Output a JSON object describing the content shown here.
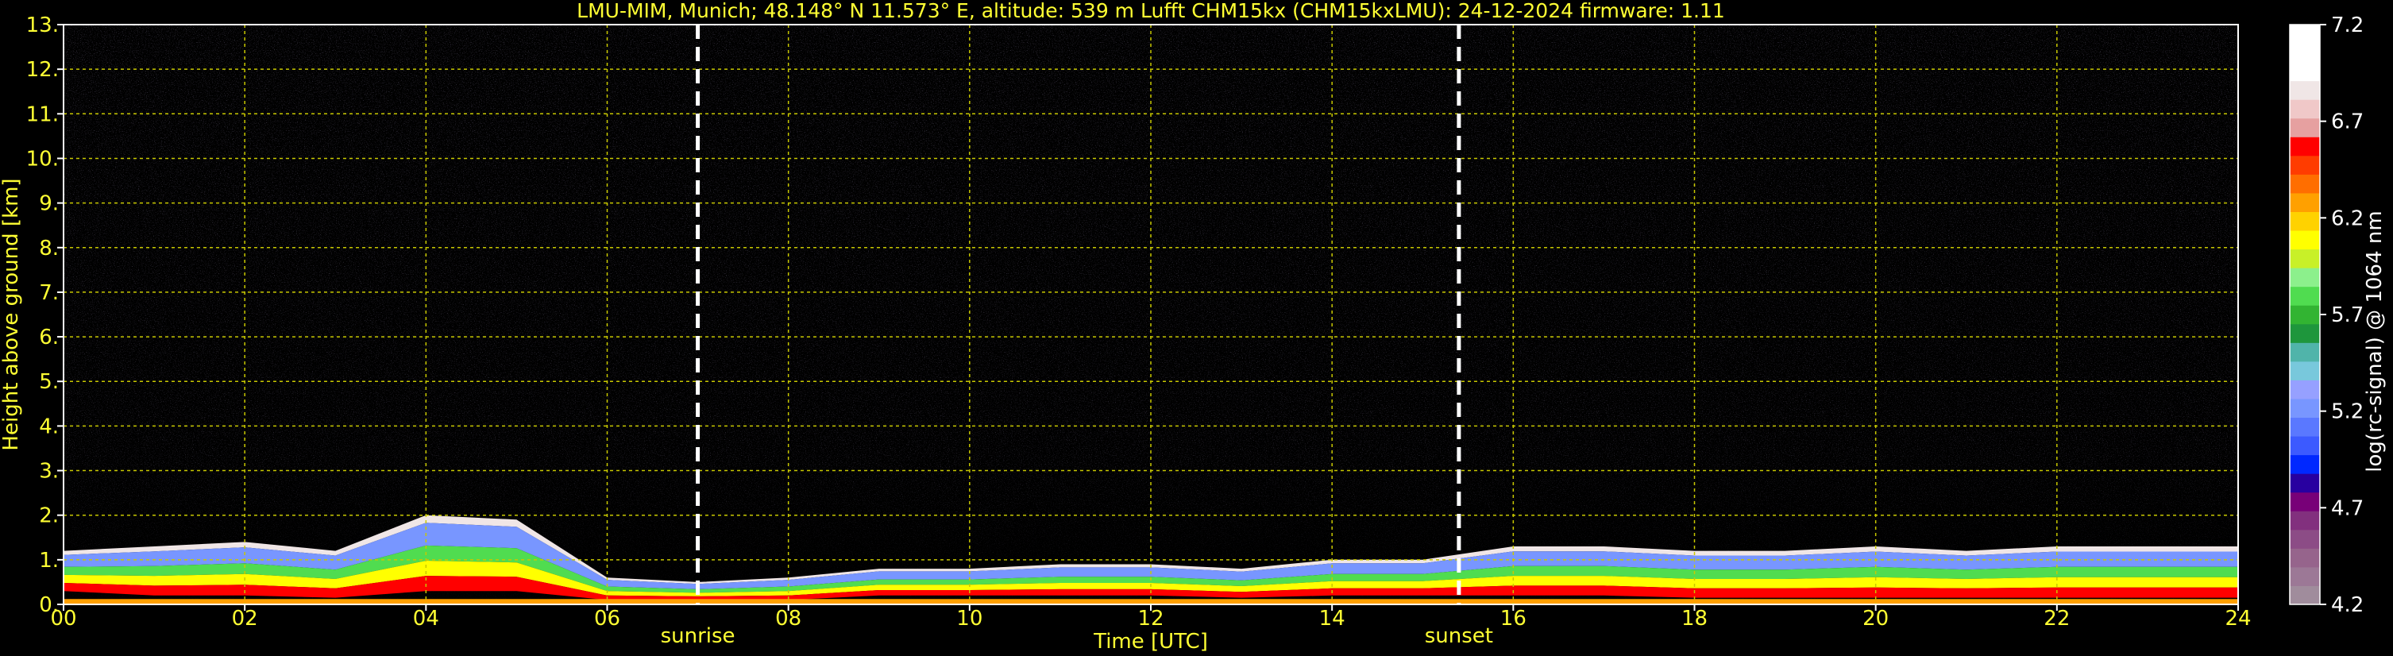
{
  "chart_data": {
    "type": "heatmap",
    "title": "LMU-MIM, Munich; 48.148° N 11.573° E, altitude: 539 m    Lufft CHM15kx (CHM15kxLMU): 24-12-2024    firmware: 1.11",
    "xlabel": "Time [UTC]",
    "ylabel": "Height above ground [km]",
    "xlim": [
      0,
      24
    ],
    "ylim": [
      0,
      13
    ],
    "x_ticks": [
      "00",
      "02",
      "04",
      "06",
      "08",
      "10",
      "12",
      "14",
      "16",
      "18",
      "20",
      "22",
      "24"
    ],
    "y_ticks": [
      "0.",
      "1.",
      "2.",
      "3.",
      "4.",
      "5.",
      "6.",
      "7.",
      "8.",
      "9.",
      "10.",
      "11.",
      "12.",
      "13."
    ],
    "grid": true,
    "colorbar": {
      "label": "log(rc-signal) @ 1064 nm",
      "range": [
        4.2,
        7.2
      ],
      "ticks": [
        "4.2",
        "4.7",
        "5.2",
        "5.7",
        "6.2",
        "6.7",
        "7.2"
      ],
      "colors": [
        "#a08c9c",
        "#9c7896",
        "#96648c",
        "#8c4c86",
        "#82307e",
        "#780078",
        "#2800a0",
        "#0028ff",
        "#3c5aff",
        "#5a78ff",
        "#7896ff",
        "#96a0ff",
        "#78c8dc",
        "#50b4aa",
        "#1e963c",
        "#32b432",
        "#50dc50",
        "#8cf08c",
        "#c8f028",
        "#ffff00",
        "#ffd200",
        "#ffa000",
        "#ff6e00",
        "#ff3c00",
        "#ff0000",
        "#e6a0a0",
        "#f0c8c8",
        "#f0e6e6",
        "#ffffff",
        "#ffffff",
        "#ffffff"
      ]
    },
    "annotations": [
      {
        "text": "sunrise",
        "x": 7.0
      },
      {
        "text": "sunset",
        "x": 15.4
      }
    ],
    "boundary_layer": [
      {
        "x": 0.0,
        "top": 1.2,
        "base": 0.3
      },
      {
        "x": 1.0,
        "top": 1.3,
        "base": 0.2
      },
      {
        "x": 2.0,
        "top": 1.4,
        "base": 0.2
      },
      {
        "x": 3.0,
        "top": 1.2,
        "base": 0.15
      },
      {
        "x": 4.0,
        "top": 2.0,
        "base": 0.3
      },
      {
        "x": 5.0,
        "top": 1.9,
        "base": 0.3
      },
      {
        "x": 6.0,
        "top": 0.6,
        "base": 0.1
      },
      {
        "x": 7.0,
        "top": 0.5,
        "base": 0.1
      },
      {
        "x": 8.0,
        "top": 0.6,
        "base": 0.1
      },
      {
        "x": 9.0,
        "top": 0.8,
        "base": 0.2
      },
      {
        "x": 10.0,
        "top": 0.8,
        "base": 0.2
      },
      {
        "x": 11.0,
        "top": 0.9,
        "base": 0.2
      },
      {
        "x": 12.0,
        "top": 0.9,
        "base": 0.2
      },
      {
        "x": 13.0,
        "top": 0.8,
        "base": 0.15
      },
      {
        "x": 14.0,
        "top": 1.0,
        "base": 0.2
      },
      {
        "x": 15.0,
        "top": 1.0,
        "base": 0.2
      },
      {
        "x": 16.0,
        "top": 1.3,
        "base": 0.2
      },
      {
        "x": 17.0,
        "top": 1.3,
        "base": 0.2
      },
      {
        "x": 18.0,
        "top": 1.2,
        "base": 0.15
      },
      {
        "x": 19.0,
        "top": 1.2,
        "base": 0.15
      },
      {
        "x": 20.0,
        "top": 1.3,
        "base": 0.15
      },
      {
        "x": 21.0,
        "top": 1.2,
        "base": 0.15
      },
      {
        "x": 22.0,
        "top": 1.3,
        "base": 0.15
      },
      {
        "x": 23.0,
        "top": 1.3,
        "base": 0.15
      },
      {
        "x": 24.0,
        "top": 1.3,
        "base": 0.15
      }
    ],
    "colors": {
      "text": "#ffff33",
      "grid": "#c8c800",
      "background": "#000000",
      "sun_lines": "#ffffff"
    }
  }
}
